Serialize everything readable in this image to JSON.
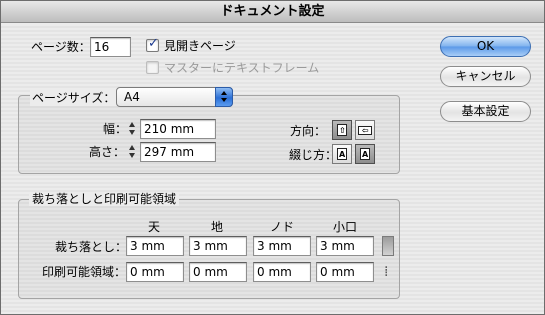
{
  "window": {
    "title": "ドキュメント設定"
  },
  "pages": {
    "label": "ページ数：",
    "value": "16",
    "facing_label": "見開きページ",
    "facing_checked": true,
    "master_text_label": "マスターにテキストフレーム",
    "master_text_checked": false
  },
  "page_size": {
    "label": "ページサイズ：",
    "selected": "A4",
    "width_label": "幅：",
    "width_value": "210 mm",
    "height_label": "高さ：",
    "height_value": "297 mm",
    "orientation_label": "方向：",
    "binding_label": "綴じ方："
  },
  "bleed": {
    "group_title": "裁ち落としと印刷可能領域",
    "columns": [
      "天",
      "地",
      "ノド",
      "小口"
    ],
    "bleed_label": "裁ち落とし：",
    "bleed_values": [
      "3 mm",
      "3 mm",
      "3 mm",
      "3 mm"
    ],
    "slug_label": "印刷可能領域：",
    "slug_values": [
      "0 mm",
      "0 mm",
      "0 mm",
      "0 mm"
    ]
  },
  "buttons": {
    "ok": "OK",
    "cancel": "キャンセル",
    "basic": "基本設定"
  },
  "icons": {
    "orientation_portrait": "portrait-page-icon",
    "orientation_landscape": "landscape-page-icon",
    "binding_left": "left-binding-icon",
    "binding_right": "right-binding-icon",
    "bleed_link": "chain-link-icon",
    "slug_link": "broken-chain-icon"
  }
}
